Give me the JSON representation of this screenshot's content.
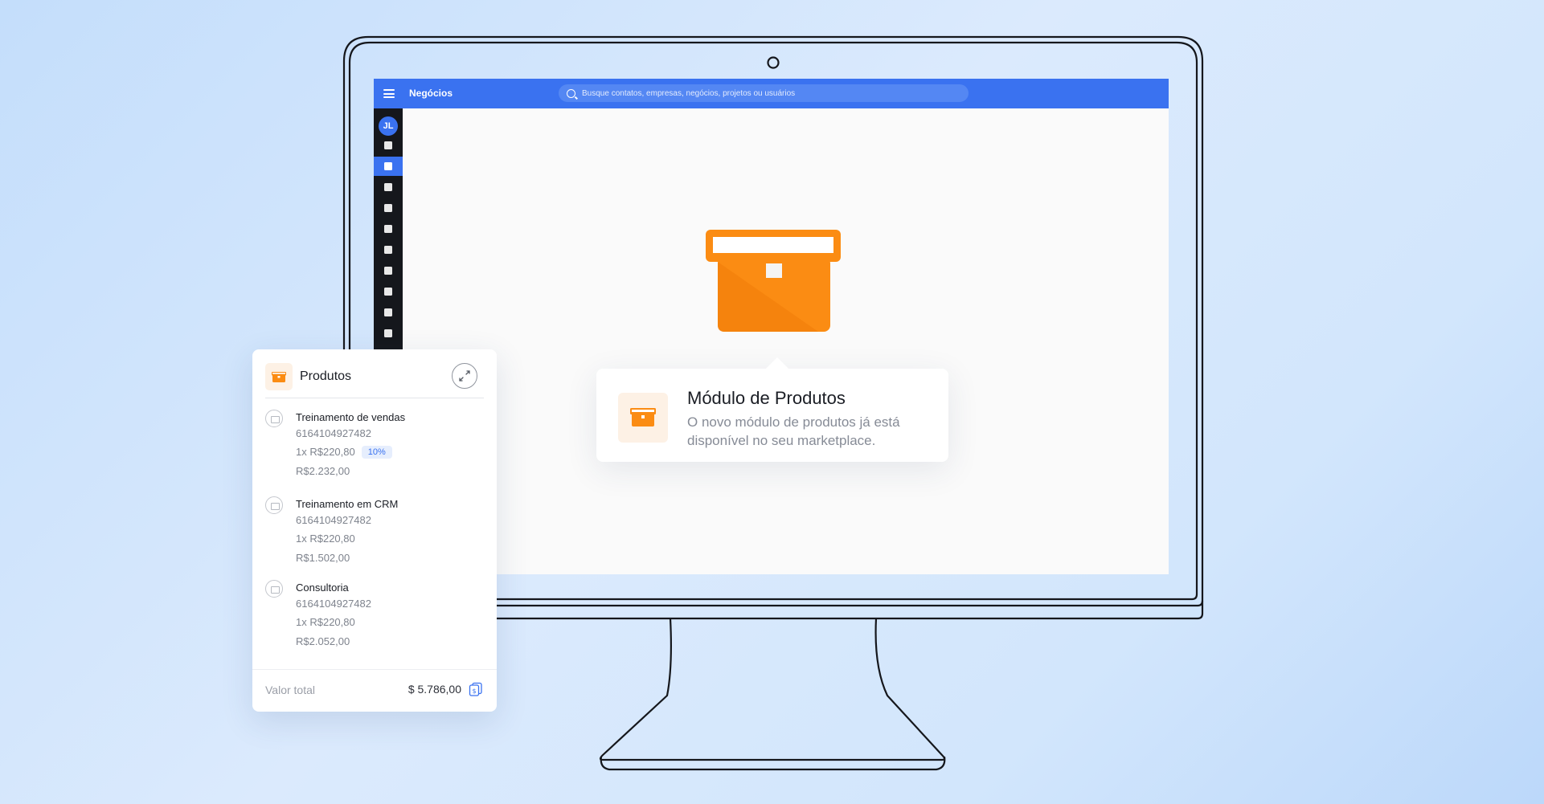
{
  "topbar": {
    "title": "Negócios",
    "search_placeholder": "Busque contatos, empresas, negócios, projetos ou usuários"
  },
  "sidebar": {
    "avatar_initials": "JL",
    "items": [
      "dashboard-icon",
      "briefcase-icon",
      "mail-icon",
      "clipboard-icon",
      "kanban-icon",
      "chart-icon",
      "contact-icon",
      "building-icon",
      "video-icon",
      "document-icon"
    ],
    "active_index": 1
  },
  "popover": {
    "title": "Módulo de Produtos",
    "text": "O novo módulo de produtos já está disponível no seu marketplace."
  },
  "card": {
    "title": "Produtos",
    "items": [
      {
        "name": "Treinamento de vendas",
        "code": "6164104927482",
        "qty_price": "1x R$220,80",
        "discount": "10%",
        "total": "R$2.232,00"
      },
      {
        "name": "Treinamento em CRM",
        "code": "6164104927482",
        "qty_price": "1x R$220,80",
        "total": "R$1.502,00"
      },
      {
        "name": "Consultoria",
        "code": "6164104927482",
        "qty_price": "1x R$220,80",
        "total": "R$2.052,00"
      }
    ],
    "total_label": "Valor total",
    "total_value": "$ 5.786,00"
  },
  "colors": {
    "accent": "#3a72f0",
    "orange": "#fb8c13",
    "sidebar_bg": "#15171c"
  }
}
